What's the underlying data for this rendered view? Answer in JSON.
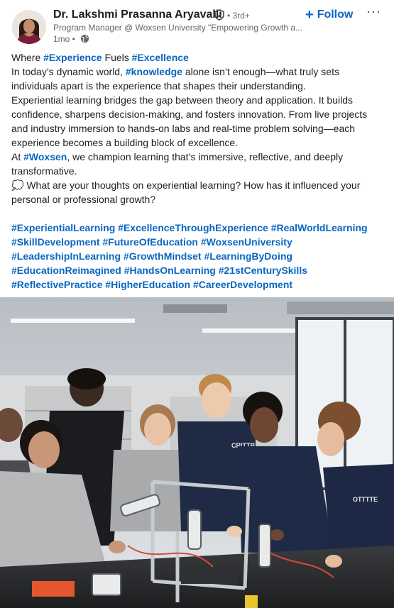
{
  "author": {
    "name": "Dr. Lakshmi Prasanna Aryavalli",
    "degree": "• 3rd+",
    "headline": "Program Manager @ Woxsen University \"Empowering Growth a...",
    "time": "1mo •"
  },
  "actions": {
    "follow_label": "Follow",
    "more_label": "···"
  },
  "post": {
    "l1_pre": "Where ",
    "l1_tag1": "#Experience",
    "l1_mid": " Fuels ",
    "l1_tag2": "#Excellence",
    "l2_pre": "In today’s dynamic world, ",
    "l2_tag": "#knowledge",
    "l2_post": " alone isn’t enough—what truly sets individuals apart is the experience that shapes their understanding.",
    "p3": "Experiential learning bridges the gap between theory and application. It builds confidence, sharpens decision-making, and fosters innovation. From live projects and industry immersion to hands-on labs and real-time problem solving—each experience becomes a building block of excellence.",
    "l4_pre": "At ",
    "l4_tag": "#Woxsen",
    "l4_post": ", we champion learning that’s immersive, reflective, and deeply transformative.",
    "question_icon": "💭",
    "question": " What are your thoughts on experiential learning? How has it influenced your personal or professional growth?",
    "hashtags": "#ExperientialLearning #ExcellenceThroughExperience #RealWorldLearning #SkillDevelopment #FutureOfEducation #WoxsenUniversity #LeadershipInLearning #GrowthMindset #LearningByDoing #EducationReimagined #HandsOnLearning #21stCenturySkills #ReflectivePractice #HigherEducation #CareerDevelopment"
  },
  "image": {
    "shirt_logo": "CRITTR",
    "shirt_logo2": "OTTTTE"
  },
  "colors": {
    "link": "#0a66c2",
    "text": "#1f1f1f",
    "muted": "#666666"
  },
  "icons": [
    "verified-shield-icon",
    "globe-icon",
    "plus-icon",
    "more-icon",
    "thought-bubble-icon"
  ]
}
